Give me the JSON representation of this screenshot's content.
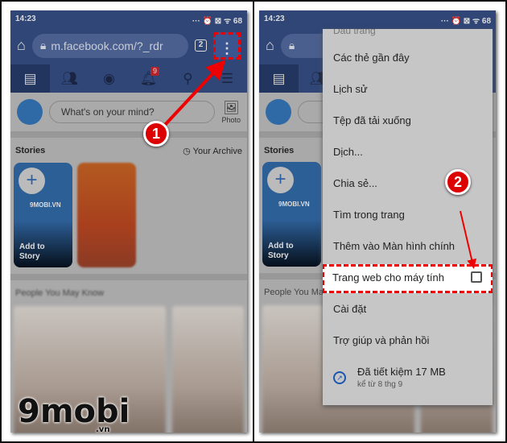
{
  "status": {
    "time": "14:23",
    "icons": "··· ⏰ ⊠ ᯤ 68"
  },
  "browser": {
    "url": "m.facebook.com/?_rdr",
    "tab_count": "2",
    "home_icon": "home-icon",
    "lock_icon": "lock-icon",
    "menu_icon": "more-vert-icon"
  },
  "nav": {
    "notification_badge": "9",
    "items": [
      "news-feed-icon",
      "friends-icon",
      "messenger-icon",
      "notifications-icon",
      "search-icon",
      "menu-icon"
    ]
  },
  "composer": {
    "placeholder": "What's on your mind?",
    "photo_label": "Photo"
  },
  "stories": {
    "title": "Stories",
    "archive": "Your Archive",
    "add_label": "Add to Story",
    "brand": "9MOBI.VN"
  },
  "people": {
    "title": "People You May Know"
  },
  "menu": {
    "partial_top": "Dấu trang",
    "items": [
      "Các thẻ gần đây",
      "Lịch sử",
      "Tệp đã tải xuống",
      "Dịch...",
      "Chia sẻ...",
      "Tìm trong trang",
      "Thêm vào Màn hình chính"
    ],
    "desktop_site": "Trang web cho máy tính",
    "desktop_site_checked": false,
    "items2": [
      "Cài đặt",
      "Trợ giúp và phản hồi"
    ],
    "saved_title": "Đã tiết kiệm 17 MB",
    "saved_sub": "kể từ 8 thg 9"
  },
  "steps": [
    "1",
    "2"
  ],
  "logo": {
    "text": "9mobi",
    "suffix": ".vn"
  },
  "colors": {
    "header": "#2f4677",
    "highlight": "#e00000",
    "badge": "#b4222a"
  }
}
